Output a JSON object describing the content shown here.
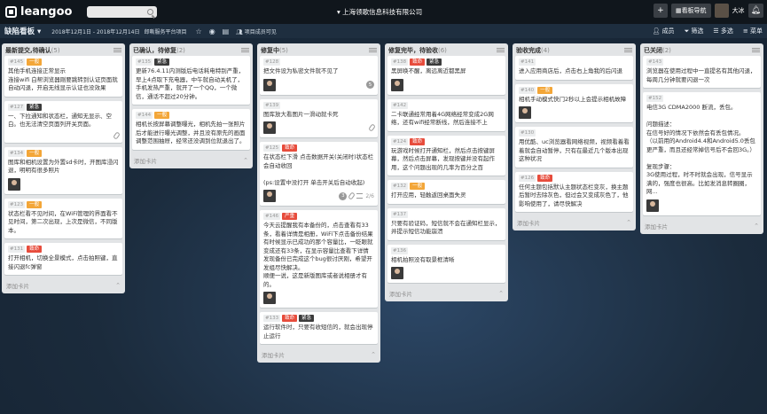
{
  "app": {
    "logo_text": "leangoo",
    "company": "上海领歌信息科技有限公司",
    "user": "大冰",
    "nav_button": "看板导航"
  },
  "board": {
    "title": "缺陷看板",
    "dates": "2018年12月1日 - 2018年12月14日",
    "owner": "郎嘶服务平台项目",
    "member_visible": "项目成员可见",
    "actions": [
      "成员",
      "筛选",
      "多选",
      "菜单"
    ]
  },
  "lists": [
    {
      "title": "最新提交,待确认",
      "count": "(5)",
      "cards": [
        {
          "id": "#145",
          "tags": [
            {
              "t": "一般",
              "c": "orange"
            }
          ],
          "text": "其他手机连接正常显示\n连接wifi 白帮浏览器刚要跳转到认证页面就自动闪退，开启无线显示认证也没效果",
          "avatar": false,
          "icons": []
        },
        {
          "id": "#127",
          "tags": [
            {
              "t": "紧急",
              "c": "dark"
            }
          ],
          "text": "一、下拉通知和状态栏，通知无显示、空白。也无法清空页面列开关页面。",
          "avatar": false,
          "icons": [
            "clip"
          ]
        },
        {
          "id": "#134",
          "tags": [
            {
              "t": "一般",
              "c": "orange"
            }
          ],
          "text": "图库和相机设置为外置sd卡时，开图库浸闪退，明明有很多照片",
          "avatar": true,
          "icons": []
        },
        {
          "id": "#123",
          "tags": [
            {
              "t": "一般",
              "c": "orange"
            }
          ],
          "text": "状态栏看不见时间，在WiFi管理的界面看不见时间，第二次出现，上次是微信，不同版本。",
          "avatar": false,
          "icons": []
        },
        {
          "id": "#131",
          "tags": [
            {
              "t": "致命",
              "c": "red"
            }
          ],
          "text": "打开相机，切换全景模式，点击拍照键，直接闪退fc弹窗",
          "avatar": false,
          "icons": []
        }
      ],
      "add": "添加卡片"
    },
    {
      "title": "已确认，待修复",
      "count": "(2)",
      "cards": [
        {
          "id": "#135",
          "tags": [
            {
              "t": "紧急",
              "c": "dark"
            }
          ],
          "text": "更新76.4.11内测版后电话耗电特别严重，早上4点取下充电器，中午就自动关机了，手机发热严重，就开了一个QQ，一个微信，通话不超过20分钟。",
          "avatar": false,
          "icons": []
        },
        {
          "id": "#144",
          "tags": [
            {
              "t": "一般",
              "c": "orange"
            }
          ],
          "text": "相机长按屏幕调整曝光，相机先拍一张照片后才能进行曝光调整，并且没有原先的画面调整范围抽屉，经常还没调到位就退出了。",
          "avatar": false,
          "icons": []
        }
      ],
      "add": "添加卡片"
    },
    {
      "title": "修复中",
      "count": "(5)",
      "cards": [
        {
          "id": "#128",
          "tags": [],
          "text": "把文件设为私密文件就不见了",
          "avatar": true,
          "icons": [],
          "badge": "5"
        },
        {
          "id": "#139",
          "tags": [],
          "text": "图库放大看图片一滑动就卡死",
          "avatar": true,
          "icons": [
            "clip"
          ]
        },
        {
          "id": "#125",
          "tags": [
            {
              "t": "致命",
              "c": "red"
            }
          ],
          "text": "在状态栏下滑 点击数据开关(关闭时)状态栏会自动收回\n\n(ps:设置中没打开 单击开关后自动收起)",
          "avatar": true,
          "icons": [
            "clip",
            "checklist"
          ],
          "badge": "3",
          "check": "2/6"
        },
        {
          "id": "#146",
          "tags": [
            {
              "t": "严重",
              "c": "red"
            }
          ],
          "text": "今天云提醒我有本备份的，点击查看有33条，看着详情是相册，WiFi下点击备份结果有时候显示已成功的那个容量比，一眨眼就变成还有33条，在显示容量比查看下详情发现备份已完成这个bug很讨厌刚，希望开发组尽快解决。\n顺便一说，这是新版图库或者说相册才有的。",
          "avatar": true,
          "icons": []
        },
        {
          "id": "#133",
          "tags": [
            {
              "t": "致命",
              "c": "red"
            },
            {
              "t": "紧急",
              "c": "dark"
            }
          ],
          "text": "运行软件时，只要有收短信的，就会出现停止运行",
          "avatar": false,
          "icons": []
        }
      ],
      "add": "添加卡片"
    },
    {
      "title": "修复完毕，待验收",
      "count": "(6)",
      "cards": [
        {
          "id": "#138",
          "tags": [
            {
              "t": "致命",
              "c": "red"
            },
            {
              "t": "紧急",
              "c": "dark"
            }
          ],
          "text": "黑屏唤不醒，离远离近都黑屏",
          "avatar": true,
          "icons": []
        },
        {
          "id": "#142",
          "tags": [],
          "text": "二卡联通经常用着4G网络经常变成2G网络，还有wifi经常断线，然后连接不上",
          "avatar": false,
          "icons": []
        },
        {
          "id": "#124",
          "tags": [
            {
              "t": "致命",
              "c": "red"
            }
          ],
          "text": "玩游戏时候打开通知栏，然后点击按键屏幕，然后点击屏幕，发现按键并没有起作用，这个问题出现的几率为百分之百",
          "avatar": false,
          "icons": []
        },
        {
          "id": "#132",
          "tags": [
            {
              "t": "一般",
              "c": "orange"
            }
          ],
          "text": "打开应用，轻触返回桌面失灵",
          "avatar": false,
          "icons": []
        },
        {
          "id": "#137",
          "tags": [],
          "text": "只要有验证码，短信就不会在通知栏显示，并提示短信功能崩溃",
          "avatar": false,
          "icons": []
        },
        {
          "id": "#136",
          "tags": [],
          "text": "相机拍照没有取景框清晰",
          "avatar": true,
          "icons": []
        }
      ],
      "add": "添加卡片"
    },
    {
      "title": "验收完成",
      "count": "(4)",
      "cards": [
        {
          "id": "#141",
          "tags": [],
          "text": "进入应用商店后，点击右上角我的后闪退",
          "avatar": false,
          "icons": []
        },
        {
          "id": "#140",
          "tags": [
            {
              "t": "一般",
              "c": "orange"
            }
          ],
          "text": "相机手动模式快门2秒以上会提示相机故障",
          "avatar": true,
          "icons": []
        },
        {
          "id": "#130",
          "tags": [],
          "text": "用优酷、uc浏览器看网络视频，视频看着看着就会自动暂停，只有在最近几个版本出现这种状况",
          "avatar": false,
          "icons": []
        },
        {
          "id": "#126",
          "tags": [
            {
              "t": "致命",
              "c": "red"
            }
          ],
          "text": "任何主题包括默认主题状态栏变灰，换主题后暂时去除灰色，但过会又变成灰色了，他影响使用了，请尽快解决",
          "avatar": false,
          "icons": []
        }
      ],
      "add": "添加卡片"
    },
    {
      "title": "已关闭",
      "count": "(2)",
      "cards": [
        {
          "id": "#143",
          "tags": [],
          "text": "浏览器在使用过程中一直提名有其他闪退，每周几分钟就要闪退一次",
          "avatar": false,
          "icons": []
        },
        {
          "id": "#152",
          "tags": [],
          "text": "电信3G CDMA2000 断流，丢包。\n\n问题描述：\n在信号好的情况下依然会有丢包情况。\n（以前用的Android4.4和Android5.0丢包更严重，而且还经常掉信号后不会回3G。）\n\n复现步骤：\n3G使用过程，时不时就会出现，信号显示满的，强度也很高。比如发消息转圈圈，网...",
          "avatar": true,
          "icons": []
        }
      ],
      "add": "添加卡片"
    }
  ]
}
